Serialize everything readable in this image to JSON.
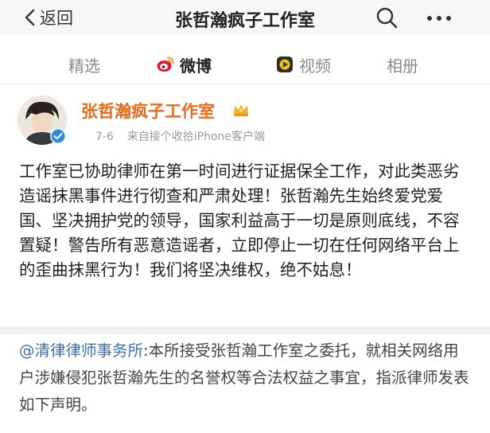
{
  "nav": {
    "back_label": "返回",
    "title": "张哲瀚疯子工作室",
    "icons": [
      "chevron-left-icon",
      "search-icon",
      "more-icon"
    ]
  },
  "tabs": [
    {
      "label": "精选",
      "active": false
    },
    {
      "label": "微博",
      "active": true,
      "icon": "weibo-icon"
    },
    {
      "label": "视频",
      "active": false,
      "icon": "video-icon"
    },
    {
      "label": "相册",
      "active": false
    }
  ],
  "post": {
    "username": "张哲瀚疯子工作室",
    "date": "7-6",
    "source": "来自接个收拾iPhone客户端",
    "text": "工作室已协助律师在第一时间进行证据保全工作，对此类恶劣造谣抹黑事件进行彻查和严肃处理！张哲瀚先生始终爱党爱国、坚决拥护党的领导，国家利益高于一切是原则底线，不容置疑！警告所有恶意造谣者，立即停止一切在任何网络平台上的歪曲抹黑行为！我们将坚决维权，绝不姑息！",
    "username_color": "#e86a1e"
  },
  "repost": {
    "mention": "@清律律师事务所",
    "text": ":本所接受张哲瀚工作室之委托，就相关网络用户涉嫌侵犯张哲瀚先生的名誉权等合法权益之事宜，指派律师发表如下声明。",
    "mention_color": "#3b6ea8"
  }
}
